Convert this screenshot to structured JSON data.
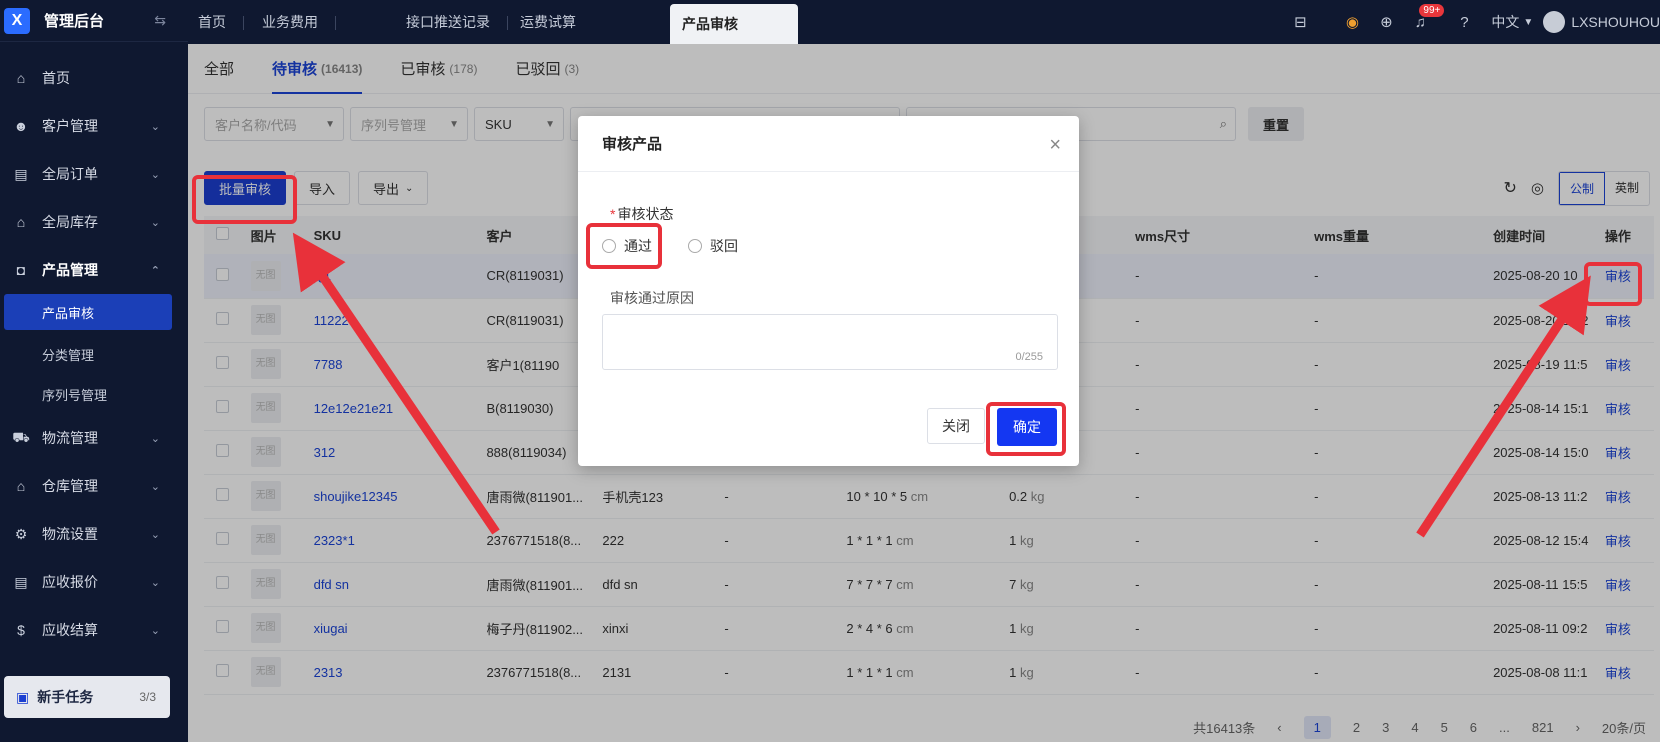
{
  "sidebar": {
    "logo_letter": "X",
    "title": "管理后台",
    "items": [
      {
        "label": "首页",
        "icon": "home-icon"
      },
      {
        "label": "客户管理",
        "icon": "users-icon"
      },
      {
        "label": "全局订单",
        "icon": "clipboard-icon"
      },
      {
        "label": "全局库存",
        "icon": "warehouse-icon"
      },
      {
        "label": "产品管理",
        "icon": "bag-icon"
      },
      {
        "label": "物流管理",
        "icon": "truck-icon"
      },
      {
        "label": "仓库管理",
        "icon": "storehouse-icon"
      },
      {
        "label": "物流设置",
        "icon": "box-gear-icon"
      },
      {
        "label": "应收报价",
        "icon": "price-doc-icon"
      },
      {
        "label": "应收结算",
        "icon": "coin-icon"
      }
    ],
    "sub_items": [
      "产品审核",
      "分类管理",
      "序列号管理"
    ],
    "task": {
      "label": "新手任务",
      "count": "3/3"
    }
  },
  "topbar": {
    "tabs": [
      "首页",
      "业务费用",
      "接口推送记录",
      "运费试算",
      "产品审核"
    ],
    "badge": "99+",
    "language": "中文",
    "user": "LXSHOUHOU"
  },
  "status_tabs": [
    {
      "label": "全部",
      "count": ""
    },
    {
      "label": "待审核",
      "count": "(16413)"
    },
    {
      "label": "已审核",
      "count": "(178)"
    },
    {
      "label": "已驳回",
      "count": "(3)"
    }
  ],
  "filters": {
    "customer_placeholder": "客户名称/代码",
    "serial_placeholder": "序列号管理",
    "sku_label": "SKU",
    "reset": "重置"
  },
  "toolbar": {
    "batch": "批量审核",
    "import": "导入",
    "export": "导出",
    "metric": "公制",
    "imperial": "英制"
  },
  "table": {
    "headers": [
      "图片",
      "SKU",
      "客户",
      "wms尺寸",
      "wms重量",
      "创建时间",
      "操作"
    ],
    "thumb": "无图",
    "action": "审核",
    "rows": [
      {
        "sku": "Q1",
        "customer": "CR(8119031)",
        "name": "",
        "extra": "",
        "size": "",
        "weight": "",
        "wms_size": "-",
        "wms_weight": "-",
        "created": "2025-08-20 10"
      },
      {
        "sku": "11222",
        "customer": "CR(8119031)",
        "name": "",
        "extra": "",
        "size": "",
        "weight": "",
        "wms_size": "-",
        "wms_weight": "-",
        "created": "2025-08-20 10:2"
      },
      {
        "sku": "7788",
        "customer": "客户1(81190",
        "name": "",
        "extra": "",
        "size": "",
        "weight": "",
        "wms_size": "-",
        "wms_weight": "-",
        "created": "2025-08-19 11:5"
      },
      {
        "sku": "12e12e21e21",
        "customer": "B(8119030)",
        "name": "",
        "extra": "",
        "size": "",
        "weight": "",
        "wms_size": "-",
        "wms_weight": "-",
        "created": "2025-08-14 15:1"
      },
      {
        "sku": "312",
        "customer": "888(8119034)",
        "name": "",
        "extra": "",
        "size": "",
        "weight": "",
        "wms_size": "-",
        "wms_weight": "-",
        "created": "2025-08-14 15:0"
      },
      {
        "sku": "shoujike12345",
        "customer": "唐雨微(811901...",
        "name": "手机壳123",
        "extra": "-",
        "size": "10 * 10 * 5",
        "weight": "0.2",
        "wms_size": "-",
        "wms_weight": "-",
        "created": "2025-08-13 11:2"
      },
      {
        "sku": "2323*1",
        "customer": "2376771518(8...",
        "name": "222",
        "extra": "-",
        "size": "1 * 1 * 1",
        "weight": "1",
        "wms_size": "-",
        "wms_weight": "-",
        "created": "2025-08-12 15:4"
      },
      {
        "sku": "dfd sn",
        "customer": "唐雨微(811901...",
        "name": "dfd sn",
        "extra": "-",
        "size": "7 * 7 * 7",
        "weight": "7",
        "wms_size": "-",
        "wms_weight": "-",
        "created": "2025-08-11 15:5"
      },
      {
        "sku": "xiugai",
        "customer": "梅子丹(811902...",
        "name": "xinxi",
        "extra": "-",
        "size": "2 * 4 * 6",
        "weight": "1",
        "wms_size": "-",
        "wms_weight": "-",
        "created": "2025-08-11 09:2"
      },
      {
        "sku": "2313",
        "customer": "2376771518(8...",
        "name": "2131",
        "extra": "-",
        "size": "1 * 1 * 1",
        "weight": "1",
        "wms_size": "-",
        "wms_weight": "-",
        "created": "2025-08-08 11:1"
      }
    ],
    "size_unit": "cm",
    "weight_unit": "kg"
  },
  "pager": {
    "total": "共16413条",
    "pages": [
      "1",
      "2",
      "3",
      "4",
      "5",
      "6",
      "...",
      "821"
    ],
    "page_size": "20条/页"
  },
  "modal": {
    "title": "审核产品",
    "status_label": "审核状态",
    "option_pass": "通过",
    "option_reject": "驳回",
    "reason_label": "审核通过原因",
    "counter": "0/255",
    "close": "关闭",
    "confirm": "确定"
  },
  "colors": {
    "annotation": "#e8313a",
    "primary": "#1437f2",
    "sidebar": "#0f1830"
  }
}
